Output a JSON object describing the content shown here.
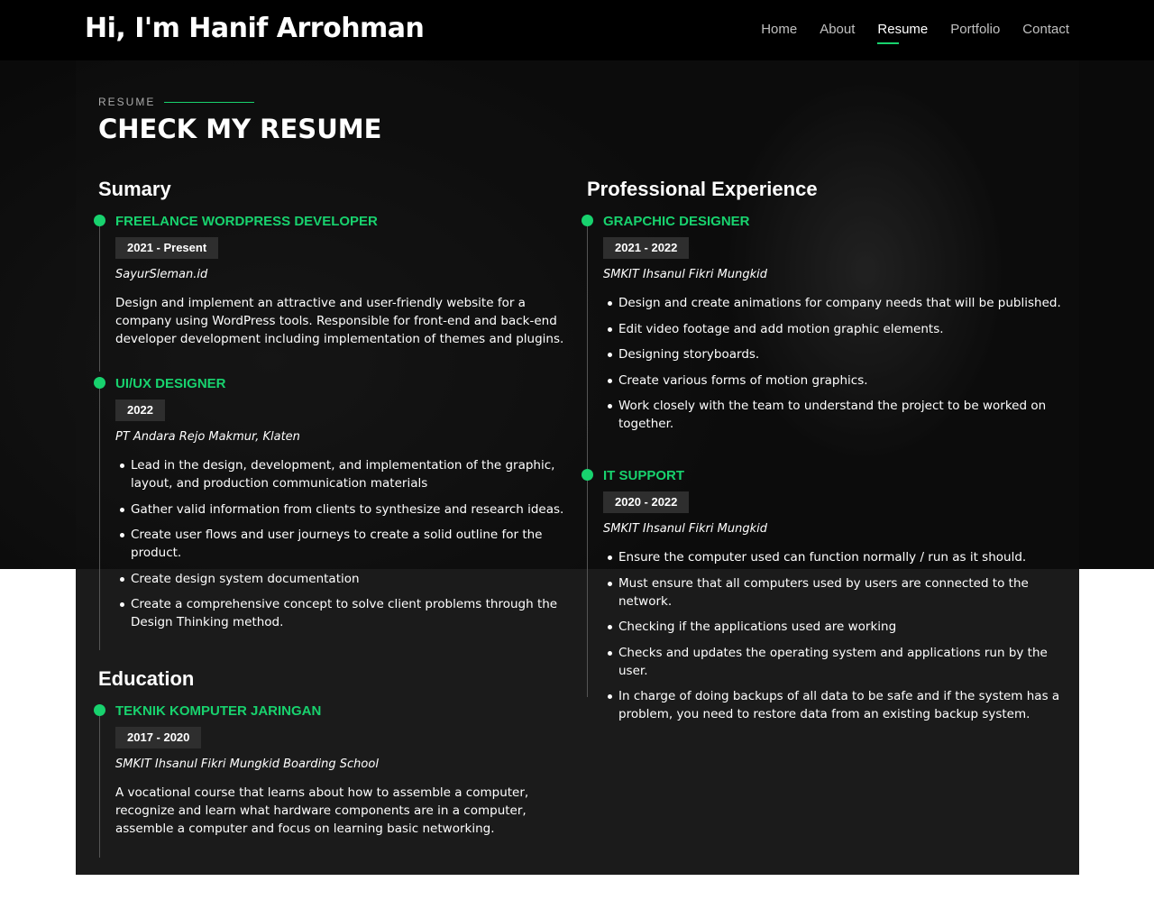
{
  "header": {
    "logo": "Hi, I'm Hanif Arrohman",
    "nav": [
      {
        "label": "Home",
        "active": false
      },
      {
        "label": "About",
        "active": false
      },
      {
        "label": "Resume",
        "active": true
      },
      {
        "label": "Portfolio",
        "active": false
      },
      {
        "label": "Contact",
        "active": false
      }
    ]
  },
  "colors": {
    "accent": "#18d26e",
    "background": "#0a0a0a",
    "panel": "#1b1b1b"
  },
  "section": {
    "eyebrow": "RESUME",
    "title": "CHECK MY RESUME"
  },
  "summary": {
    "heading": "Sumary",
    "items": [
      {
        "title": "FREELANCE WORDPRESS DEVELOPER",
        "date": "2021 - Present",
        "org": "SayurSleman.id",
        "desc": "Design and implement an attractive and user-friendly website for a company using WordPress tools. Responsible for front-end and back-end developer development including implementation of themes and plugins."
      },
      {
        "title": "UI/UX DESIGNER",
        "date": "2022",
        "org": "PT Andara Rejo Makmur, Klaten",
        "bullets": [
          "Lead in the design, development, and implementation of the graphic, layout, and production communication materials",
          "Gather valid information from clients to synthesize and research ideas.",
          "Create user flows and user journeys to create a solid outline for the product.",
          "Create design system documentation",
          "Create a comprehensive concept to solve client problems through the Design Thinking method."
        ]
      }
    ]
  },
  "education": {
    "heading": "Education",
    "items": [
      {
        "title": "TEKNIK KOMPUTER JARINGAN",
        "date": "2017 - 2020",
        "org": "SMKIT Ihsanul Fikri Mungkid Boarding School",
        "desc": "A vocational course that learns about how to assemble a computer, recognize and learn what hardware components are in a computer, assemble a computer and focus on learning basic networking."
      }
    ]
  },
  "experience": {
    "heading": "Professional Experience",
    "items": [
      {
        "title": "GRAPCHIC DESIGNER",
        "date": "2021 - 2022",
        "org": "SMKIT Ihsanul Fikri Mungkid",
        "bullets": [
          "Design and create animations for company needs that will be published.",
          "Edit video footage and add motion graphic elements.",
          "Designing storyboards.",
          "Create various forms of motion graphics.",
          "Work closely with the team to understand the project to be worked on together."
        ]
      },
      {
        "title": "IT SUPPORT",
        "date": "2020 - 2022",
        "org": "SMKIT Ihsanul Fikri Mungkid",
        "bullets": [
          "Ensure the computer used can function normally / run as it should.",
          "Must ensure that all computers used by users are connected to the network.",
          "Checking if the applications used are working",
          "Checks and updates the operating system and applications run by the user.",
          "In charge of doing backups of all data to be safe and if the system has a problem, you need to restore data from an existing backup system."
        ]
      }
    ]
  }
}
